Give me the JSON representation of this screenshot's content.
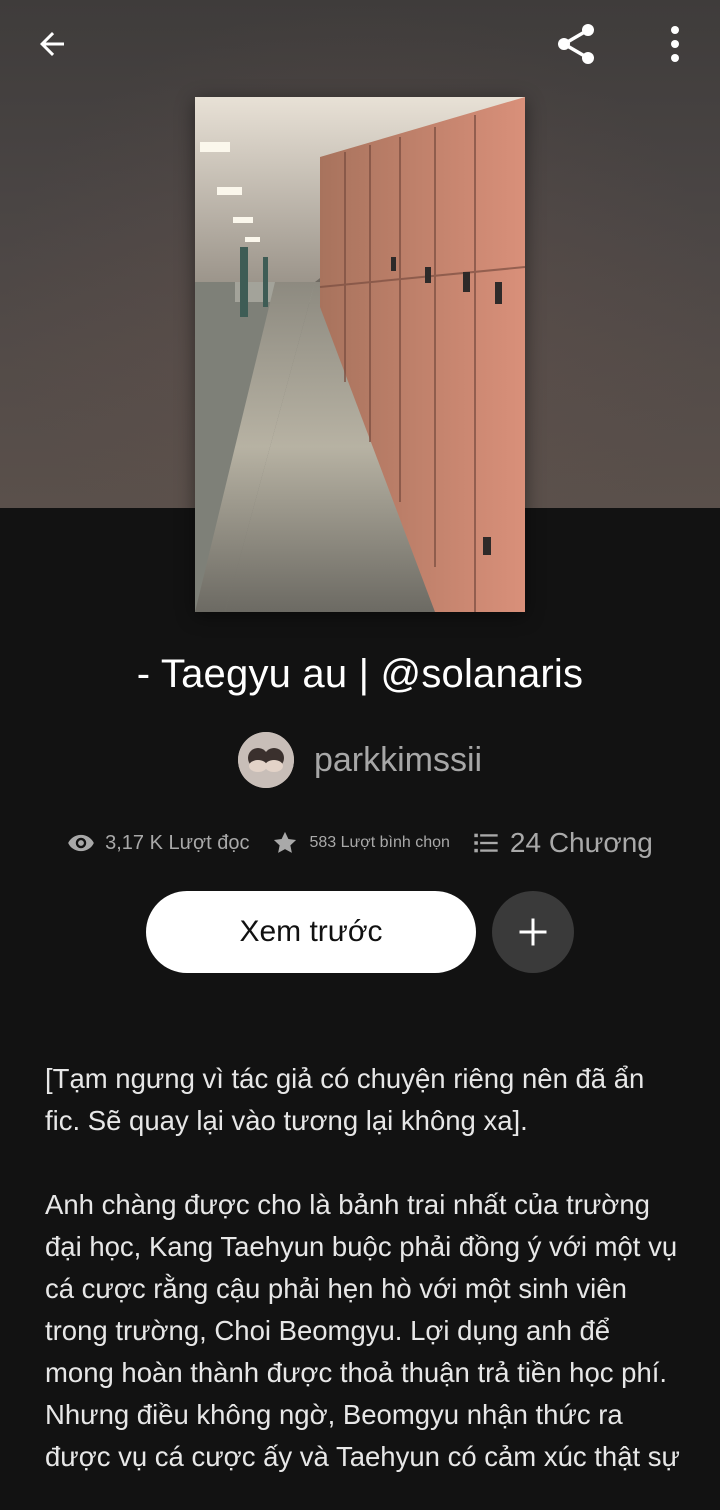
{
  "header": {
    "back_icon": "arrow-left-icon",
    "share_icon": "share-icon",
    "more_icon": "more-vertical-icon"
  },
  "story": {
    "title": "- Taegyu au | @solanaris",
    "author": "parkkimssii",
    "stats": {
      "reads": "3,17 K Lượt đọc",
      "votes": "583 Lượt bình chọn",
      "parts": "24 Chương"
    }
  },
  "actions": {
    "preview_label": "Xem trước",
    "add_icon": "plus-icon"
  },
  "description": {
    "para1": "[Tạm ngưng vì tác giả có chuyện riêng nên đã ẩn fic. Sẽ quay lại vào tương lại không xa].",
    "para2": "Anh chàng được cho là bảnh trai nhất của trường đại học, Kang Taehyun buộc phải đồng ý với một vụ cá cược rằng cậu phải hẹn hò với một sinh viên trong trường, Choi Beomgyu. Lợi dụng anh để mong hoàn thành được thoả thuận trả tiền học phí. Nhưng điều không ngờ, Beomgyu nhận thức ra được vụ cá cược ấy và Taehyun có cảm xúc thật sự"
  },
  "colors": {
    "background": "#121212",
    "accent_text": "#a9a9a9",
    "button_bg": "#ffffff",
    "add_button_bg": "#3a3a3a"
  }
}
